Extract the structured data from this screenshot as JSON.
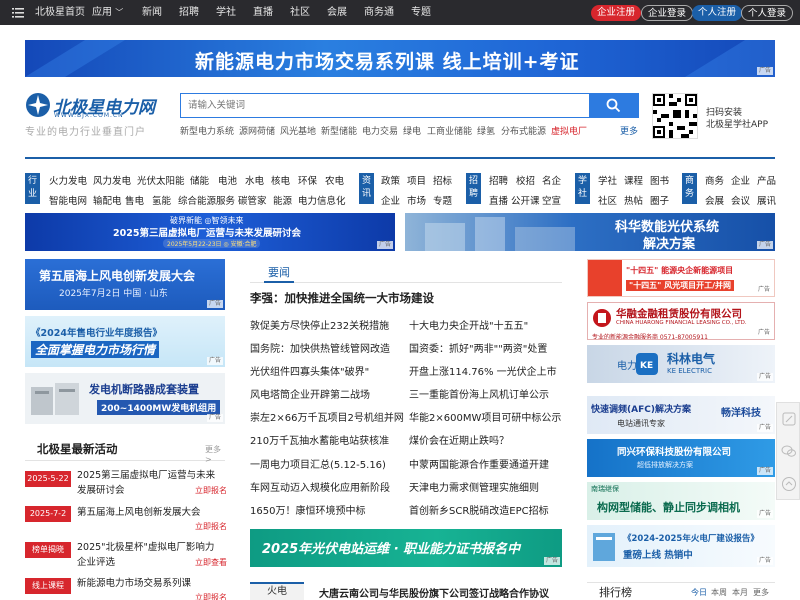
{
  "topbar": {
    "home": "北极星首页",
    "apps": "应用",
    "nav": [
      "新闻",
      "招聘",
      "学社",
      "直播",
      "社区",
      "会展",
      "商务通",
      "专题"
    ],
    "enterprise_register": "企业注册",
    "enterprise_login": "企业登录",
    "personal_register": "个人注册",
    "personal_login": "个人登录"
  },
  "top_banner": {
    "text": "新能源电力市场交易系列课   线上培训+考证",
    "ad": "广告"
  },
  "header": {
    "logo_name": "北极星电力网",
    "logo_domain": "WWW.BJX.COM.CN",
    "slogan": "专业的电力行业垂直门户",
    "search_placeholder": "请输入关键词",
    "hot_links": [
      "新型电力系统",
      "源网荷储",
      "风光基地",
      "新型储能",
      "电力交易",
      "绿电",
      "工商业储能",
      "绿氢",
      "分布式能源",
      "虚拟电厂"
    ],
    "more": "更多",
    "qr_line1": "扫码安装",
    "qr_line2": "北极星学社APP"
  },
  "nav": {
    "industry": {
      "tag": "行业",
      "row1": [
        "火力发电",
        "风力发电",
        "光伏太阳能",
        "储能",
        "电池",
        "水电",
        "核电",
        "环保",
        "农电"
      ],
      "row2": [
        "智能电网",
        "输配电",
        "售电",
        "氢能",
        "综合能源服务",
        "碳管家",
        "能源",
        "电力信息化"
      ]
    },
    "news": {
      "tag": "资讯",
      "row1": [
        "政策",
        "项目",
        "招标"
      ],
      "row2": [
        "企业",
        "市场",
        "专题"
      ]
    },
    "jobs": {
      "tag": "招聘",
      "row1": [
        "招聘",
        "校招",
        "名企"
      ],
      "row2": [
        "直播",
        "公开课",
        "空宣"
      ]
    },
    "school": {
      "tag": "学社",
      "row1": [
        "学社",
        "课程",
        "图书"
      ],
      "row2": [
        "社区",
        "热帖",
        "圈子"
      ]
    },
    "business": {
      "tag": "商务",
      "row1": [
        "商务",
        "企业",
        "产品"
      ],
      "row2": [
        "会展",
        "会议",
        "展讯"
      ]
    }
  },
  "mid_banners": {
    "left": {
      "line1": "破界新能 ◎智领未来",
      "line2": "2025第三届虚拟电厂运营与未来发展研讨会",
      "line3": "2025年5月22-23日 ◎ 安徽·合肥",
      "ad": "广告"
    },
    "right": {
      "line1": "科华数能光伏系统",
      "line2": "解决方案",
      "ad": "广告"
    }
  },
  "left_ads": [
    {
      "line1": "第五届海上风电创新发展大会",
      "line2": "2025年7月2日   中国 · 山东",
      "ad": "广告"
    },
    {
      "line1": "《2024年售电行业年度报告》",
      "line2": "全面掌握电力市场行情",
      "ad": "广告"
    },
    {
      "line1": "发电机断路器成套装置",
      "line2": "200~1400MW发电机组用",
      "ad": "广告"
    }
  ],
  "activities": {
    "title": "北极星最新活动",
    "more": "更多>",
    "items": [
      {
        "tag": "2025-5-22",
        "title": "2025第三届虚拟电厂运营与未来发展研讨会",
        "action": "立即报名"
      },
      {
        "tag": "2025-7-2",
        "title": "第五届海上风电创新发展大会",
        "action": "立即报名"
      },
      {
        "tag": "榜单揭晓",
        "title": "2025\"北极星杯\"虚拟电厂影响力企业评选",
        "action": "立即查看"
      },
      {
        "tag": "线上课程",
        "title": "新能源电力市场交易系列课",
        "action": "立即报名"
      }
    ]
  },
  "news": {
    "tab": "要闻",
    "headline": "李强：加快推进全国统一大市场建设",
    "left": [
      "敦促美方尽快停止232关税措施",
      "国务院：加快供热管线管网改造",
      "光伏组件四寡头集体\"破界\"",
      "风电塔筒企业开辟第二战场",
      "崇左2×66万千瓦项目2号机组并网",
      "210万千瓦抽水蓄能电站获核准",
      "一周电力项目汇总(5.12-5.16)",
      "车网互动迈入规模化应用新阶段",
      "1650万！康恒环境预中标"
    ],
    "right": [
      "十大电力央企开战\"十五五\"",
      "国资委：抓好\"两非\"\"两资\"处置",
      "开盘上涨114.76% 一光伏企上市",
      "三一重能首份海上风机订单公示",
      "华能2×600MW项目可研中标公示",
      "煤价会在近期止跌吗？",
      "中蒙两国能源合作重要通道开建",
      "天津电力需求侧管理实施细则",
      "首创新乡SCR脱硝改造EPC招标"
    ]
  },
  "cert_banner": {
    "text": "2025年光伏电站运维 · 职业能力证书报名中",
    "ad": "广告"
  },
  "bottom": {
    "tag": "火电",
    "headline": "大唐云南公司与华民股份旗下公司签订战略合作协议",
    "rank_title": "排行榜",
    "rank_tabs": [
      "今日",
      "本周",
      "本月",
      "更多>"
    ]
  },
  "right_ads": [
    {
      "line1": "\"十四五\" 能源央企新能源项目",
      "line2": "\"十四五\" 风光项目开工/并网",
      "ad": "广告"
    },
    {
      "line1": "华融金融租赁股份有限公司",
      "line2": "CHINA HUARONG FINANCIAL LEASING CO., LTD.",
      "line3": "专业的新能源金融服务商 0571-87005911",
      "ad": "广告"
    },
    {
      "line1": "科林电气",
      "line2": "KE ELECTRIC",
      "line3": "电力",
      "ad": "广告"
    },
    {
      "line1": "快速调频(AFC)解决方案",
      "line2": "电站通讯专家",
      "line3": "畅洋科技",
      "ad": "广告"
    },
    {
      "line1": "同兴环保科技股份有限公司",
      "line2": "超低排放解决方案",
      "ad": "广告"
    },
    {
      "line1": "构网型储能、静止同步调相机",
      "line2": "南瑞继保",
      "ad": "广告"
    },
    {
      "line1": "《2024-2025年火电厂建设报告》",
      "line2": "重磅上线 热销中",
      "ad": "广告"
    }
  ],
  "colors": {
    "brand_blue": "#1b5fa8",
    "accent_red": "#d7262d",
    "topbar": "#2a2a2e"
  }
}
